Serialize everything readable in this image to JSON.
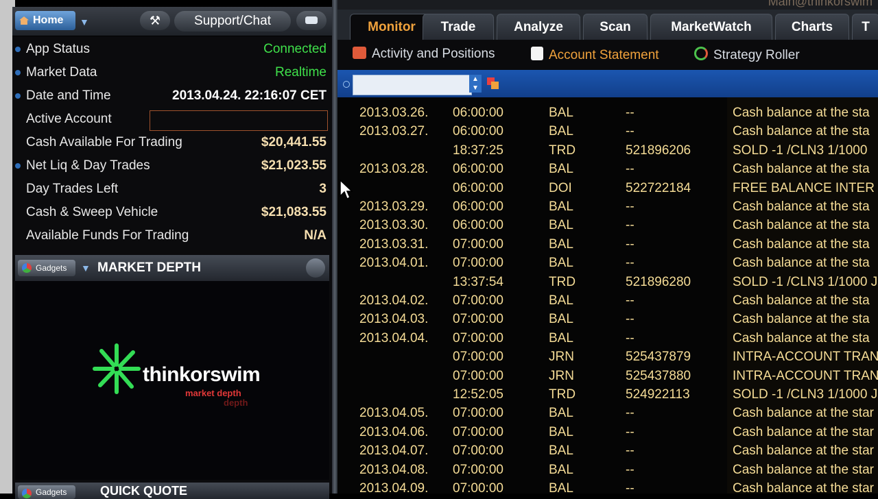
{
  "header": {
    "home_label": "Home",
    "support_label": "Support/Chat",
    "top_right_text": "Main@thinkorswim"
  },
  "status": [
    {
      "label": "App Status",
      "value": "Connected",
      "dot": true,
      "style": "green"
    },
    {
      "label": "Market Data",
      "value": "Realtime",
      "dot": true,
      "style": "green"
    },
    {
      "label": "Date and Time",
      "value": "2013.04.24. 22:16:07 CET",
      "dot": true,
      "style": "white"
    },
    {
      "label": "Active Account",
      "value": "",
      "dot": false,
      "style": "account"
    },
    {
      "label": "Cash Available For Trading",
      "value": "$20,441.55",
      "dot": false,
      "style": "cream"
    },
    {
      "label": "Net Liq & Day Trades",
      "value": "$21,023.55",
      "dot": true,
      "style": "cream"
    },
    {
      "label": "Day Trades Left",
      "value": "3",
      "dot": false,
      "style": "cream"
    },
    {
      "label": "Cash & Sweep Vehicle",
      "value": "$21,083.55",
      "dot": false,
      "style": "cream"
    },
    {
      "label": "Available Funds For Trading",
      "value": "N/A",
      "dot": false,
      "style": "cream"
    }
  ],
  "gadget": {
    "pill_label": "Gadgets",
    "title": "MARKET DEPTH",
    "logo_name": "thinkorswim",
    "logo_sub": "market depth",
    "logo_sub2": "depth",
    "next_title": "QUICK QUOTE"
  },
  "tabs": [
    "Monitor",
    "Trade",
    "Analyze",
    "Scan",
    "MarketWatch",
    "Charts",
    "T"
  ],
  "active_tab": "Monitor",
  "subtabs": [
    "Activity and Positions",
    "Account Statement",
    "Strategy Roller"
  ],
  "active_subtab": "Account Statement",
  "filter": {
    "value": ""
  },
  "colors": {
    "accent": "#f0a23c",
    "text_cream": "#f5dc96",
    "green": "#3fe04a",
    "blue_bar": "#1b56b0"
  },
  "rows": [
    {
      "date": "2013.03.26.",
      "time": "06:00:00",
      "type": "BAL",
      "ref": "--",
      "desc": "Cash balance at the sta"
    },
    {
      "date": "2013.03.27.",
      "time": "06:00:00",
      "type": "BAL",
      "ref": "--",
      "desc": "Cash balance at the sta"
    },
    {
      "date": "",
      "time": "18:37:25",
      "type": "TRD",
      "ref": "521896206",
      "desc": "SOLD -1 /CLN3 1/1000"
    },
    {
      "date": "2013.03.28.",
      "time": "06:00:00",
      "type": "BAL",
      "ref": "--",
      "desc": "Cash balance at the sta"
    },
    {
      "date": "",
      "time": "06:00:00",
      "type": "DOI",
      "ref": "522722184",
      "desc": "FREE BALANCE INTER"
    },
    {
      "date": "2013.03.29.",
      "time": "06:00:00",
      "type": "BAL",
      "ref": "--",
      "desc": "Cash balance at the sta"
    },
    {
      "date": "2013.03.30.",
      "time": "06:00:00",
      "type": "BAL",
      "ref": "--",
      "desc": "Cash balance at the sta"
    },
    {
      "date": "2013.03.31.",
      "time": "07:00:00",
      "type": "BAL",
      "ref": "--",
      "desc": "Cash balance at the sta"
    },
    {
      "date": "2013.04.01.",
      "time": "07:00:00",
      "type": "BAL",
      "ref": "--",
      "desc": "Cash balance at the sta"
    },
    {
      "date": "",
      "time": "13:37:54",
      "type": "TRD",
      "ref": "521896280",
      "desc": "SOLD -1 /CLN3 1/1000 J"
    },
    {
      "date": "2013.04.02.",
      "time": "07:00:00",
      "type": "BAL",
      "ref": "--",
      "desc": "Cash balance at the sta"
    },
    {
      "date": "2013.04.03.",
      "time": "07:00:00",
      "type": "BAL",
      "ref": "--",
      "desc": "Cash balance at the sta"
    },
    {
      "date": "2013.04.04.",
      "time": "07:00:00",
      "type": "BAL",
      "ref": "--",
      "desc": "Cash balance at the sta"
    },
    {
      "date": "",
      "time": "07:00:00",
      "type": "JRN",
      "ref": "525437879",
      "desc": "INTRA-ACCOUNT TRAN"
    },
    {
      "date": "",
      "time": "07:00:00",
      "type": "JRN",
      "ref": "525437880",
      "desc": "INTRA-ACCOUNT TRAN"
    },
    {
      "date": "",
      "time": "12:52:05",
      "type": "TRD",
      "ref": "524922113",
      "desc": "SOLD -1 /CLN3 1/1000 J"
    },
    {
      "date": "2013.04.05.",
      "time": "07:00:00",
      "type": "BAL",
      "ref": "--",
      "desc": "Cash balance at the star"
    },
    {
      "date": "2013.04.06.",
      "time": "07:00:00",
      "type": "BAL",
      "ref": "--",
      "desc": "Cash balance at the star"
    },
    {
      "date": "2013.04.07.",
      "time": "07:00:00",
      "type": "BAL",
      "ref": "--",
      "desc": "Cash balance at the star"
    },
    {
      "date": "2013.04.08.",
      "time": "07:00:00",
      "type": "BAL",
      "ref": "--",
      "desc": "Cash balance at the star"
    },
    {
      "date": "2013.04.09.",
      "time": "07:00:00",
      "type": "BAL",
      "ref": "--",
      "desc": "Cash balance at the star"
    }
  ]
}
